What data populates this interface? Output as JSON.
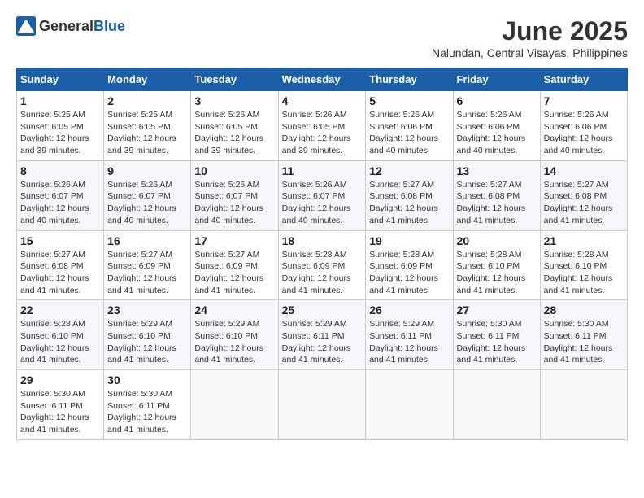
{
  "logo": {
    "text_general": "General",
    "text_blue": "Blue"
  },
  "title": "June 2025",
  "subtitle": "Nalundan, Central Visayas, Philippines",
  "days_of_week": [
    "Sunday",
    "Monday",
    "Tuesday",
    "Wednesday",
    "Thursday",
    "Friday",
    "Saturday"
  ],
  "weeks": [
    [
      {
        "day": "1",
        "info": "Sunrise: 5:25 AM\nSunset: 6:05 PM\nDaylight: 12 hours\nand 39 minutes."
      },
      {
        "day": "2",
        "info": "Sunrise: 5:25 AM\nSunset: 6:05 PM\nDaylight: 12 hours\nand 39 minutes."
      },
      {
        "day": "3",
        "info": "Sunrise: 5:26 AM\nSunset: 6:05 PM\nDaylight: 12 hours\nand 39 minutes."
      },
      {
        "day": "4",
        "info": "Sunrise: 5:26 AM\nSunset: 6:05 PM\nDaylight: 12 hours\nand 39 minutes."
      },
      {
        "day": "5",
        "info": "Sunrise: 5:26 AM\nSunset: 6:06 PM\nDaylight: 12 hours\nand 40 minutes."
      },
      {
        "day": "6",
        "info": "Sunrise: 5:26 AM\nSunset: 6:06 PM\nDaylight: 12 hours\nand 40 minutes."
      },
      {
        "day": "7",
        "info": "Sunrise: 5:26 AM\nSunset: 6:06 PM\nDaylight: 12 hours\nand 40 minutes."
      }
    ],
    [
      {
        "day": "8",
        "info": "Sunrise: 5:26 AM\nSunset: 6:07 PM\nDaylight: 12 hours\nand 40 minutes."
      },
      {
        "day": "9",
        "info": "Sunrise: 5:26 AM\nSunset: 6:07 PM\nDaylight: 12 hours\nand 40 minutes."
      },
      {
        "day": "10",
        "info": "Sunrise: 5:26 AM\nSunset: 6:07 PM\nDaylight: 12 hours\nand 40 minutes."
      },
      {
        "day": "11",
        "info": "Sunrise: 5:26 AM\nSunset: 6:07 PM\nDaylight: 12 hours\nand 40 minutes."
      },
      {
        "day": "12",
        "info": "Sunrise: 5:27 AM\nSunset: 6:08 PM\nDaylight: 12 hours\nand 41 minutes."
      },
      {
        "day": "13",
        "info": "Sunrise: 5:27 AM\nSunset: 6:08 PM\nDaylight: 12 hours\nand 41 minutes."
      },
      {
        "day": "14",
        "info": "Sunrise: 5:27 AM\nSunset: 6:08 PM\nDaylight: 12 hours\nand 41 minutes."
      }
    ],
    [
      {
        "day": "15",
        "info": "Sunrise: 5:27 AM\nSunset: 6:08 PM\nDaylight: 12 hours\nand 41 minutes."
      },
      {
        "day": "16",
        "info": "Sunrise: 5:27 AM\nSunset: 6:09 PM\nDaylight: 12 hours\nand 41 minutes."
      },
      {
        "day": "17",
        "info": "Sunrise: 5:27 AM\nSunset: 6:09 PM\nDaylight: 12 hours\nand 41 minutes."
      },
      {
        "day": "18",
        "info": "Sunrise: 5:28 AM\nSunset: 6:09 PM\nDaylight: 12 hours\nand 41 minutes."
      },
      {
        "day": "19",
        "info": "Sunrise: 5:28 AM\nSunset: 6:09 PM\nDaylight: 12 hours\nand 41 minutes."
      },
      {
        "day": "20",
        "info": "Sunrise: 5:28 AM\nSunset: 6:10 PM\nDaylight: 12 hours\nand 41 minutes."
      },
      {
        "day": "21",
        "info": "Sunrise: 5:28 AM\nSunset: 6:10 PM\nDaylight: 12 hours\nand 41 minutes."
      }
    ],
    [
      {
        "day": "22",
        "info": "Sunrise: 5:28 AM\nSunset: 6:10 PM\nDaylight: 12 hours\nand 41 minutes."
      },
      {
        "day": "23",
        "info": "Sunrise: 5:29 AM\nSunset: 6:10 PM\nDaylight: 12 hours\nand 41 minutes."
      },
      {
        "day": "24",
        "info": "Sunrise: 5:29 AM\nSunset: 6:10 PM\nDaylight: 12 hours\nand 41 minutes."
      },
      {
        "day": "25",
        "info": "Sunrise: 5:29 AM\nSunset: 6:11 PM\nDaylight: 12 hours\nand 41 minutes."
      },
      {
        "day": "26",
        "info": "Sunrise: 5:29 AM\nSunset: 6:11 PM\nDaylight: 12 hours\nand 41 minutes."
      },
      {
        "day": "27",
        "info": "Sunrise: 5:30 AM\nSunset: 6:11 PM\nDaylight: 12 hours\nand 41 minutes."
      },
      {
        "day": "28",
        "info": "Sunrise: 5:30 AM\nSunset: 6:11 PM\nDaylight: 12 hours\nand 41 minutes."
      }
    ],
    [
      {
        "day": "29",
        "info": "Sunrise: 5:30 AM\nSunset: 6:11 PM\nDaylight: 12 hours\nand 41 minutes."
      },
      {
        "day": "30",
        "info": "Sunrise: 5:30 AM\nSunset: 6:11 PM\nDaylight: 12 hours\nand 41 minutes."
      },
      {
        "day": "",
        "info": ""
      },
      {
        "day": "",
        "info": ""
      },
      {
        "day": "",
        "info": ""
      },
      {
        "day": "",
        "info": ""
      },
      {
        "day": "",
        "info": ""
      }
    ]
  ]
}
